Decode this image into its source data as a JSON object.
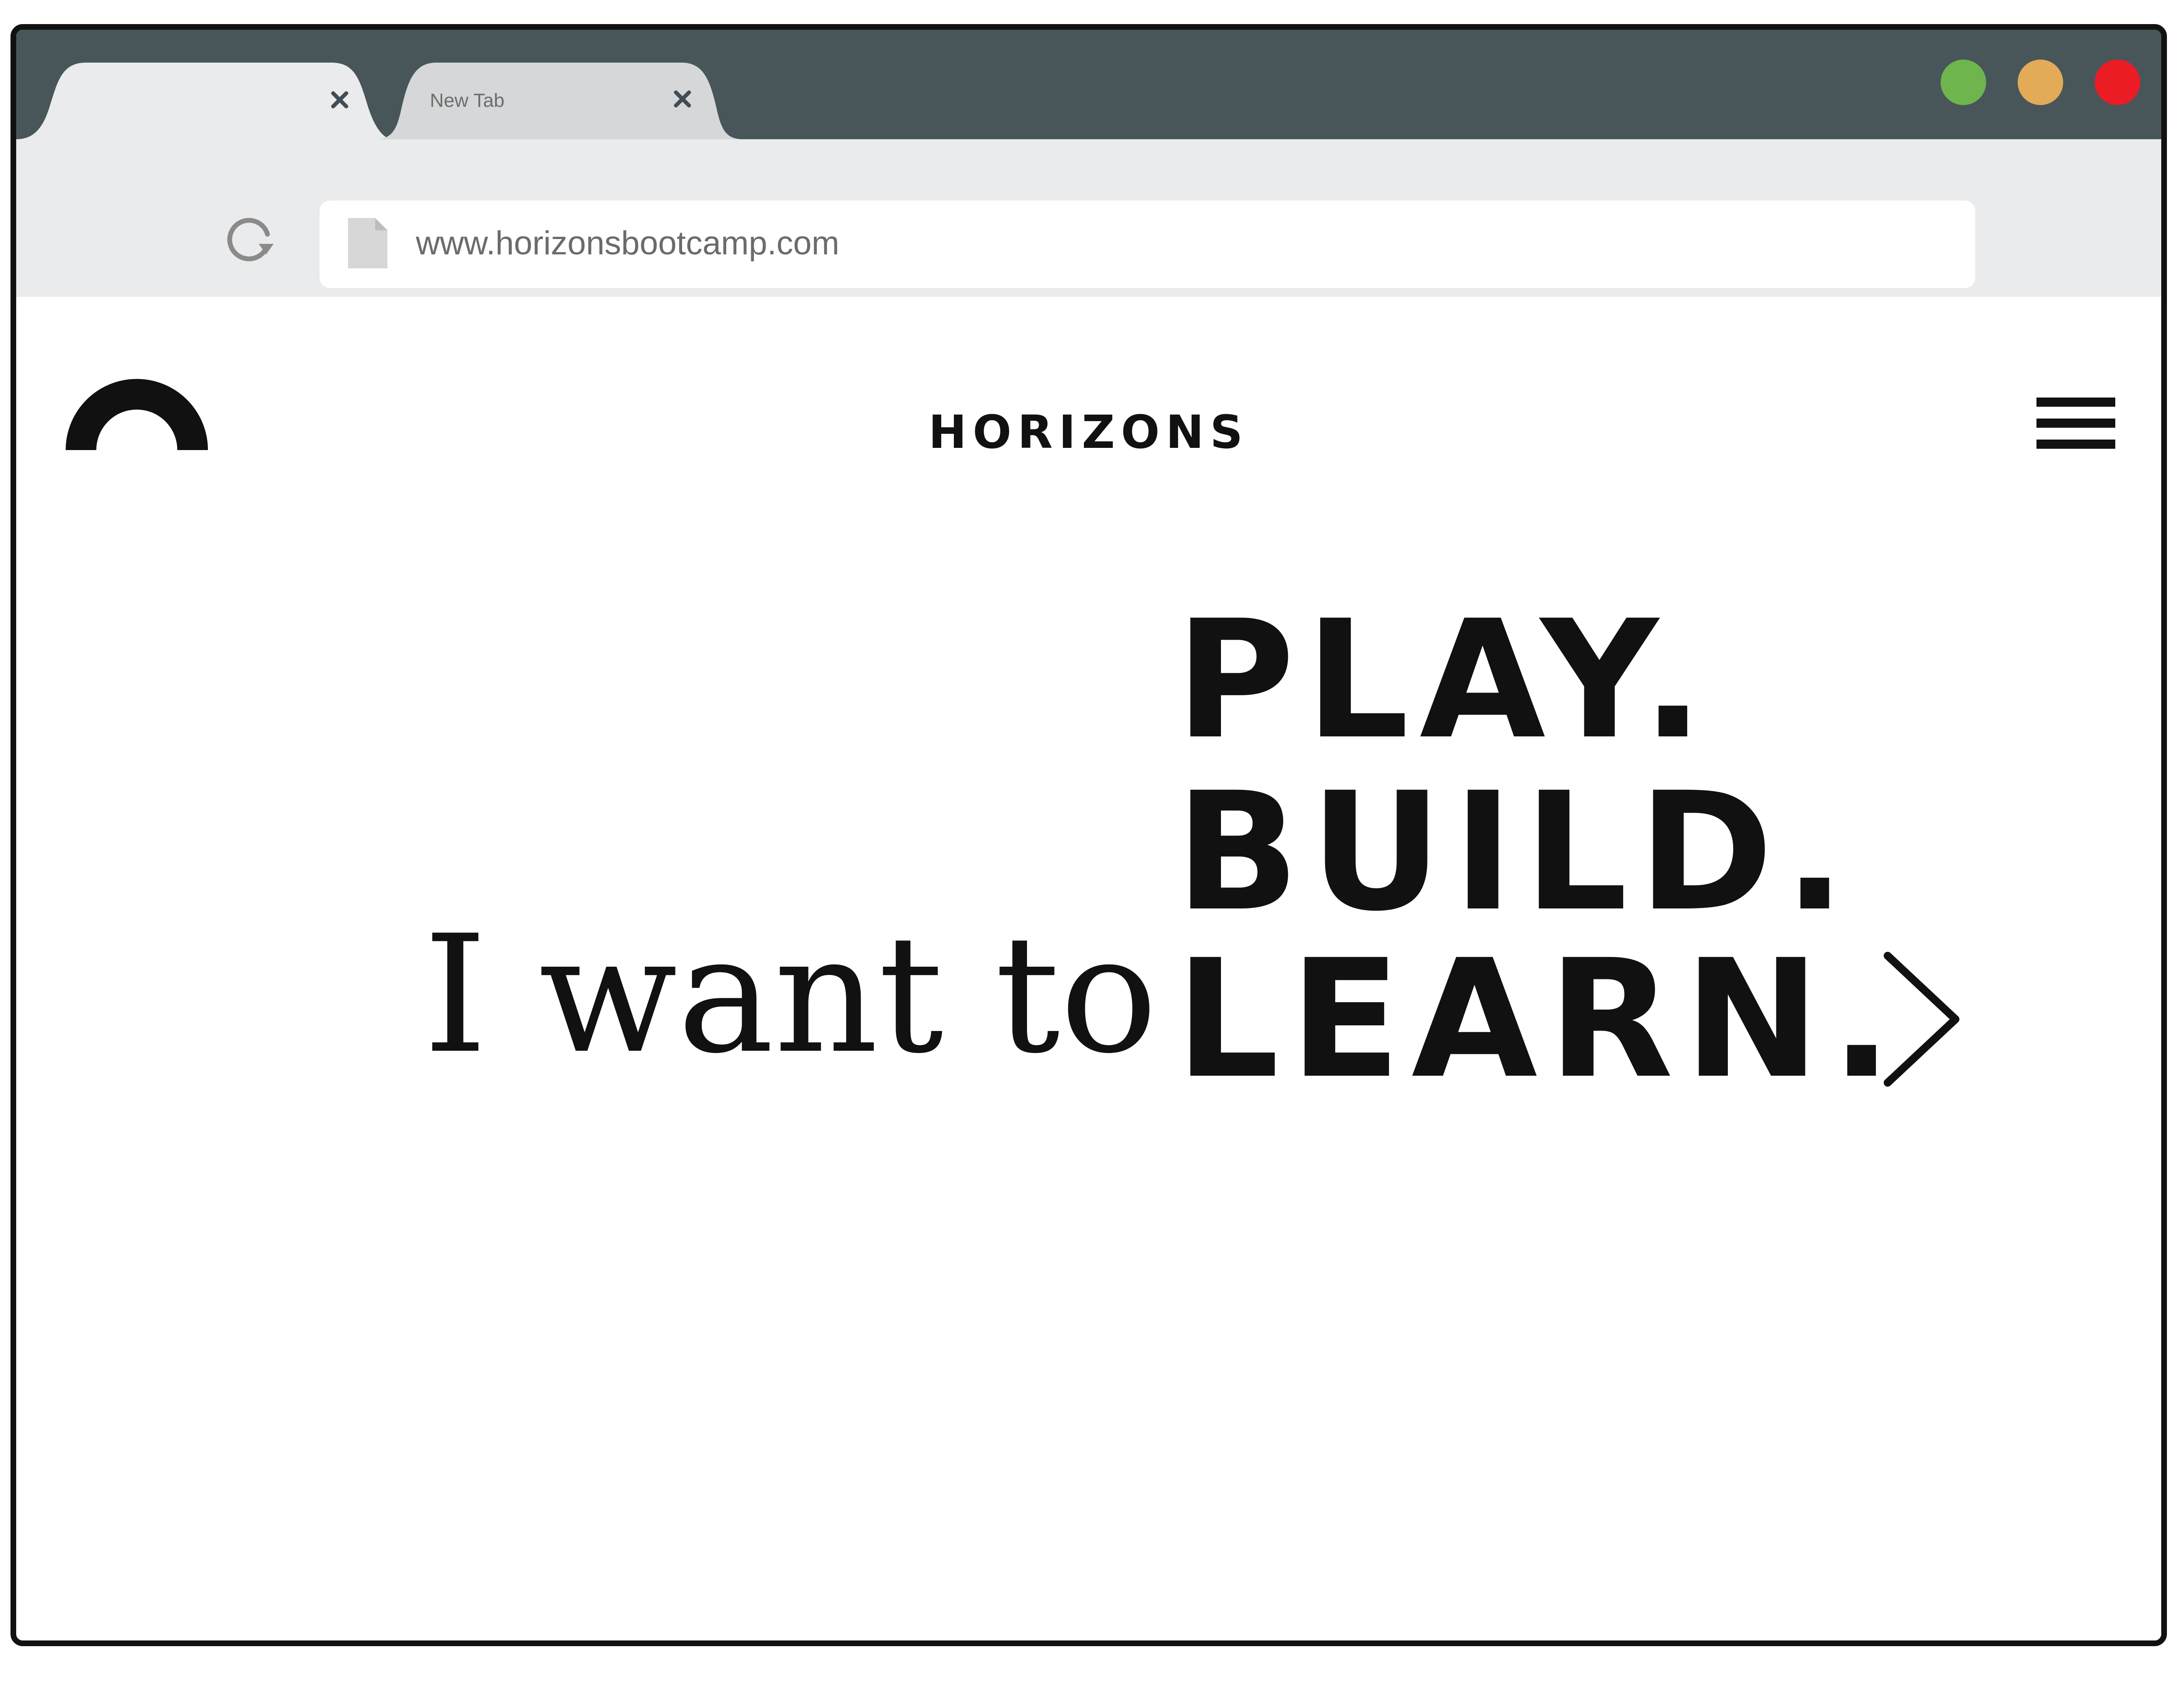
{
  "browser": {
    "tabs": [
      {
        "title": "",
        "active": true
      },
      {
        "title": "New Tab",
        "active": false
      }
    ],
    "close_glyph": "×",
    "window_controls": [
      {
        "name": "maximize",
        "color": "#6db54c"
      },
      {
        "name": "minimize",
        "color": "#e3aa57"
      },
      {
        "name": "close",
        "color": "#ec1c24"
      }
    ],
    "url": "www.horizonsbootcamp.com",
    "colors": {
      "titlebar": "#48565a",
      "toolbar": "#eaebec",
      "active_tab": "#eaebec",
      "inactive_tab": "#d6d7d8"
    }
  },
  "site": {
    "brand": "HORIZONS",
    "hero": {
      "lead": "I want to",
      "words": [
        "PLAY.",
        "BUILD.",
        "LEARN."
      ]
    },
    "icons": {
      "logo": "arc-logo-icon",
      "menu": "hamburger-menu-icon",
      "next": "chevron-right-icon"
    }
  }
}
